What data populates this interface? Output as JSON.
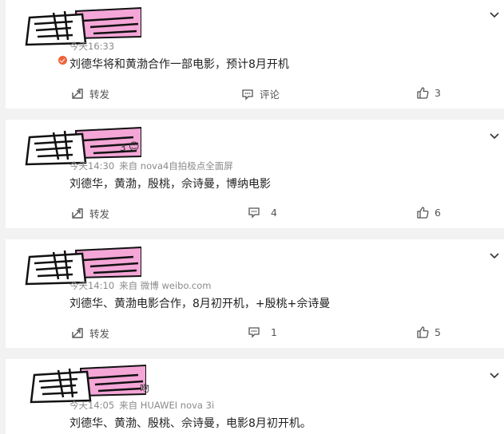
{
  "colors": {
    "background": "#f2f2f2",
    "card": "#ffffff",
    "mask_pink": "#f4a6d7",
    "badge": "#f0623a",
    "meta": "#8a8a8a"
  },
  "icons": {
    "repost": "share-square-icon",
    "comment": "comment-icon",
    "like": "thumb-up-icon",
    "menu": "chevron-down-icon"
  },
  "posts": [
    {
      "name_fragment": "",
      "time": "今天16:33",
      "source": "",
      "content": "刘德华将和黄渤合作一部电影，预计8月开机",
      "repost_label": "转发",
      "comment_label": "评论",
      "like_count": "3"
    },
    {
      "name_fragment": "3",
      "time": "今天14:30",
      "source": "来自 nova4自拍极点全面屏",
      "content": "刘德华，黄渤，殷桃，佘诗曼，博纳电影",
      "repost_label": "转发",
      "comment_count": "4",
      "like_count": "6"
    },
    {
      "name_fragment": "",
      "time": "今天14:10",
      "source": "来自 微博 weibo.com",
      "content": "刘德华、黄渤电影合作，8月初开机，+殷桃+佘诗曼",
      "repost_label": "转发",
      "comment_count": "1",
      "like_count": "5"
    },
    {
      "name_fragment": "吻",
      "time": "今天14:05",
      "source": "来自 HUAWEI nova 3i",
      "content": "刘德华、黄渤、殷桃、佘诗曼，电影8月初开机。",
      "repost_label": "",
      "comment_count": "",
      "like_count": ""
    }
  ]
}
